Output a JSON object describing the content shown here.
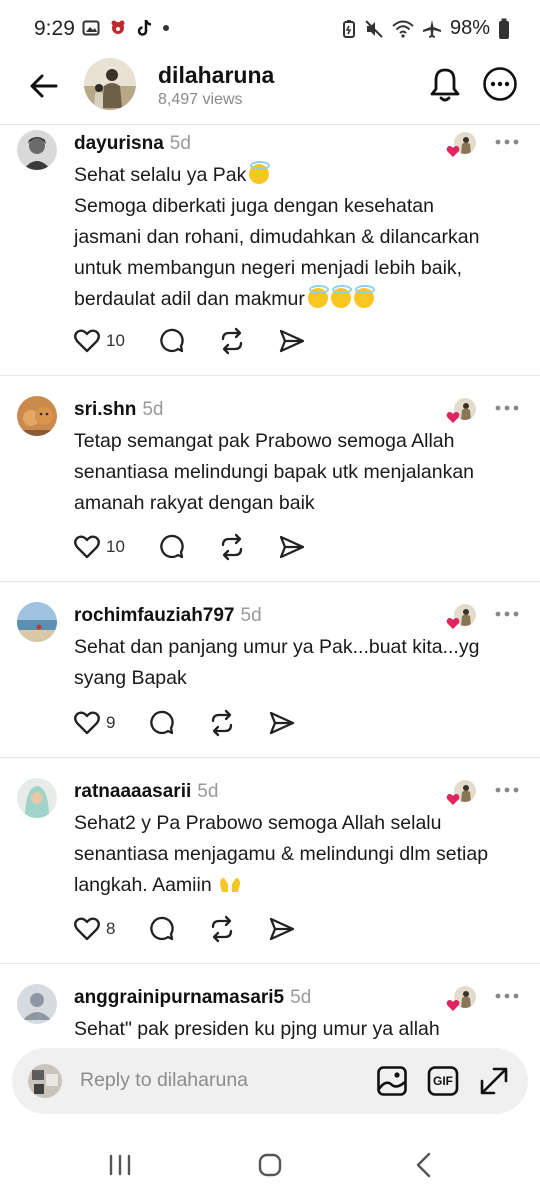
{
  "status_bar": {
    "time": "9:29",
    "battery": "98%",
    "left_icons": [
      "gallery-icon",
      "app-icon",
      "tiktok-icon",
      "dot-icon"
    ],
    "right_icons": [
      "battery-saver-icon",
      "mute-icon",
      "wifi-icon",
      "airplane-icon",
      "battery-icon"
    ]
  },
  "header": {
    "title": "dilaharuna",
    "views": "8,497 views"
  },
  "comments": [
    {
      "user": "dayurisna",
      "time": "5d",
      "lines": [
        "Sehat selalu ya Pak",
        "Semoga diberkati juga dengan kesehatan",
        "jasmani dan rohani, dimudahkan & dilancarkan",
        "untuk membangun negeri menjadi lebih baik,",
        "berdaulat adil dan makmur"
      ],
      "likes": "10"
    },
    {
      "user": "sri.shn",
      "time": "5d",
      "lines": [
        "Tetap semangat pak Prabowo semoga Allah",
        "senantiasa melindungi bapak utk menjalankan",
        "amanah rakyat dengan baik"
      ],
      "likes": "10"
    },
    {
      "user": "rochimfauziah797",
      "time": "5d",
      "lines": [
        "Sehat dan panjang umur ya Pak...buat kita...yg",
        "syang Bapak"
      ],
      "likes": "9"
    },
    {
      "user": "ratnaaaasarii",
      "time": "5d",
      "lines": [
        "Sehat2 y Pa Prabowo semoga Allah selalu",
        "senantiasa menjagamu & melindungi dlm setiap",
        "langkah. Aamiin"
      ],
      "likes": "8"
    },
    {
      "user": "anggrainipurnamasari5",
      "time": "5d",
      "lines": [
        "Sehat\" pak presiden ku pjng umur ya allah"
      ],
      "likes": ""
    }
  ],
  "reply": {
    "placeholder": "Reply to dilaharuna",
    "gif_label": "GIF"
  },
  "colors": {
    "heart_red": "#e0245e",
    "muted_text": "#8a8a8a",
    "emoji_yellow": "#f7c623"
  }
}
